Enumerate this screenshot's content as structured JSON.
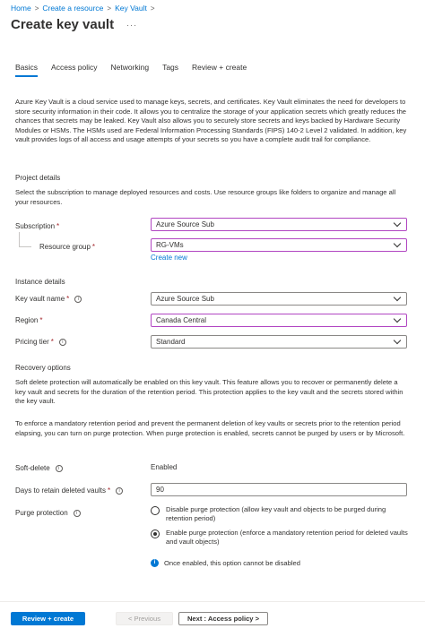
{
  "breadcrumb": {
    "items": [
      "Home",
      "Create a resource",
      "Key Vault"
    ],
    "separator": ">"
  },
  "header": {
    "title": "Create key vault",
    "more": "···"
  },
  "tabs": [
    {
      "label": "Basics",
      "active": true
    },
    {
      "label": "Access policy"
    },
    {
      "label": "Networking"
    },
    {
      "label": "Tags"
    },
    {
      "label": "Review + create"
    }
  ],
  "intro": "Azure Key Vault is a cloud service used to manage keys, secrets, and certificates. Key Vault eliminates the need for developers to store security information in their code. It allows you to centralize the storage of your application secrets which greatly reduces the chances that secrets may be leaked. Key Vault also allows you to securely store secrets and keys backed by Hardware Security Modules or HSMs. The HSMs used are Federal Information Processing Standards (FIPS) 140-2 Level 2 validated. In addition, key vault provides logs of all access and usage attempts of your secrets so you have a complete audit trail for compliance.",
  "project": {
    "heading": "Project details",
    "description": "Select the subscription to manage deployed resources and costs. Use resource groups like folders to organize and manage all your resources.",
    "subscription_label": "Subscription",
    "subscription_value": "Azure Source Sub",
    "resource_group_label": "Resource group",
    "resource_group_value": "RG-VMs",
    "create_new": "Create new"
  },
  "instance": {
    "heading": "Instance details",
    "name_label": "Key vault name",
    "name_value": "Azure Source Sub",
    "region_label": "Region",
    "region_value": "Canada Central",
    "tier_label": "Pricing tier",
    "tier_value": "Standard"
  },
  "recovery": {
    "heading": "Recovery options",
    "para1": "Soft delete protection will automatically be enabled on this key vault. This feature allows you to recover or permanently delete a key vault and secrets for the duration of the retention period. This protection applies to the key vault and the secrets stored within the key vault.",
    "para2": "To enforce a mandatory retention period and prevent the permanent deletion of key vaults or secrets prior to the retention period elapsing, you can turn on purge protection. When purge protection is enabled, secrets cannot be purged by users or by Microsoft.",
    "soft_delete_label": "Soft-delete",
    "soft_delete_value": "Enabled",
    "days_label": "Days to retain deleted vaults",
    "days_value": "90",
    "purge_label": "Purge protection",
    "purge_option1": "Disable purge protection (allow key vault and objects to be purged during retention period)",
    "purge_option2": "Enable purge protection (enforce a mandatory retention period for deleted vaults and vault objects)",
    "purge_selected": 2,
    "note": "Once enabled, this option cannot be disabled"
  },
  "footer": {
    "review_create": "Review + create",
    "previous": "< Previous",
    "next": "Next : Access policy >"
  },
  "colors": {
    "accent": "#0078d4",
    "required": "#a4262c",
    "focus_border": "#b146c2"
  },
  "icons": {
    "info": "info-icon",
    "chevron": "chevron-down-icon",
    "more": "ellipsis-icon"
  }
}
